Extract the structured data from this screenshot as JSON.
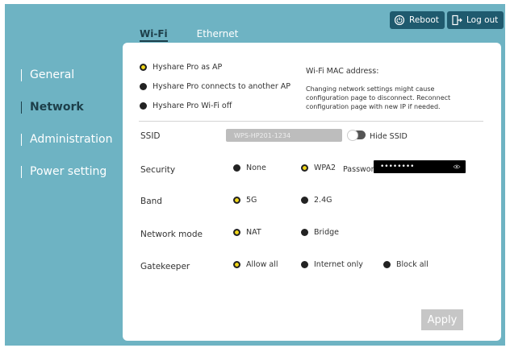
{
  "topbar": {
    "reboot_label": "Reboot",
    "logout_label": "Log out"
  },
  "tabs": [
    {
      "label": "Wi-Fi",
      "active": true
    },
    {
      "label": "Ethernet",
      "active": false
    }
  ],
  "sidebar": {
    "items": [
      {
        "label": "General",
        "active": false
      },
      {
        "label": "Network",
        "active": true
      },
      {
        "label": "Administration",
        "active": false
      },
      {
        "label": "Power setting",
        "active": false
      }
    ]
  },
  "wifi": {
    "modes": [
      {
        "label": "Hyshare Pro as AP",
        "selected": true
      },
      {
        "label": "Hyshare Pro connects to another AP",
        "selected": false
      },
      {
        "label": "Hyshare Pro Wi-Fi off",
        "selected": false
      }
    ],
    "mac_label": "Wi-Fi MAC address:",
    "note": "Changing network settings might cause configuration page to disconnect. Reconnect configuration page with new IP if needed.",
    "ssid": {
      "label": "SSID",
      "value": "WPS-HP201-1234",
      "hide_label": "Hide SSID",
      "hidden": false
    },
    "security": {
      "label": "Security",
      "options": [
        {
          "label": "None",
          "selected": false
        },
        {
          "label": "WPA2",
          "selected": true
        }
      ],
      "password_label": "Password:",
      "password_value": "••••••••"
    },
    "band": {
      "label": "Band",
      "options": [
        {
          "label": "5G",
          "selected": true
        },
        {
          "label": "2.4G",
          "selected": false
        }
      ]
    },
    "network_mode": {
      "label": "Network mode",
      "options": [
        {
          "label": "NAT",
          "selected": true
        },
        {
          "label": "Bridge",
          "selected": false
        }
      ]
    },
    "gatekeeper": {
      "label": "Gatekeeper",
      "options": [
        {
          "label": "Allow all",
          "selected": true
        },
        {
          "label": "Internet only",
          "selected": false
        },
        {
          "label": "Block all",
          "selected": false
        }
      ]
    },
    "apply_label": "Apply"
  },
  "colors": {
    "background": "#6eb3c3",
    "header_button": "#1f5a6e",
    "active_text": "#1d3f4a",
    "selected_radio": "#f3d81a",
    "apply_disabled": "#c6c6c6"
  },
  "icons": {
    "reboot": "power-cycle-icon",
    "logout": "door-exit-icon",
    "password": "eye-icon"
  }
}
